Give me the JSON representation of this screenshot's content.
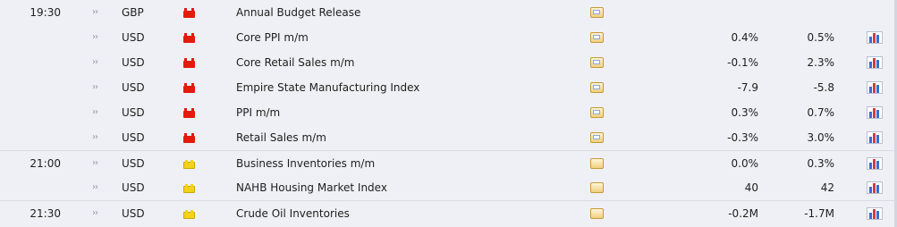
{
  "columns": [
    "time",
    "volatility",
    "currency",
    "importance",
    "event",
    "detail",
    "actual",
    "forecast",
    "chart"
  ],
  "colors": {
    "high_importance": "#e41a0d",
    "medium_importance": "#f3d21a",
    "row_bg": "#eef0f5"
  },
  "rows": [
    {
      "time": "19:30",
      "volatility": "››",
      "currency": "GBP",
      "importance": "high",
      "event": "Annual Budget Release",
      "detail_icon": "open-folder-icon",
      "actual": "",
      "forecast": "",
      "chart": false
    },
    {
      "time": "",
      "volatility": "››",
      "currency": "USD",
      "importance": "high",
      "event": "Core PPI m/m",
      "detail_icon": "open-folder-icon",
      "actual": "0.4%",
      "forecast": "0.5%",
      "chart": true
    },
    {
      "time": "",
      "volatility": "››",
      "currency": "USD",
      "importance": "high",
      "event": "Core Retail Sales m/m",
      "detail_icon": "open-folder-icon",
      "actual": "-0.1%",
      "forecast": "2.3%",
      "chart": true
    },
    {
      "time": "",
      "volatility": "››",
      "currency": "USD",
      "importance": "high",
      "event": "Empire State Manufacturing Index",
      "detail_icon": "open-folder-icon",
      "actual": "-7.9",
      "forecast": "-5.8",
      "chart": true
    },
    {
      "time": "",
      "volatility": "››",
      "currency": "USD",
      "importance": "high",
      "event": "PPI m/m",
      "detail_icon": "open-folder-icon",
      "actual": "0.3%",
      "forecast": "0.7%",
      "chart": true
    },
    {
      "time": "",
      "volatility": "››",
      "currency": "USD",
      "importance": "high",
      "event": "Retail Sales m/m",
      "detail_icon": "open-folder-icon",
      "actual": "-0.3%",
      "forecast": "3.0%",
      "chart": true
    },
    {
      "time": "21:00",
      "volatility": "››",
      "currency": "USD",
      "importance": "medium",
      "event": "Business Inventories m/m",
      "detail_icon": "folder-icon",
      "actual": "0.0%",
      "forecast": "0.3%",
      "chart": true
    },
    {
      "time": "",
      "volatility": "››",
      "currency": "USD",
      "importance": "medium",
      "event": "NAHB Housing Market Index",
      "detail_icon": "folder-icon",
      "actual": "40",
      "forecast": "42",
      "chart": true
    },
    {
      "time": "21:30",
      "volatility": "››",
      "currency": "USD",
      "importance": "medium",
      "event": "Crude Oil Inventories",
      "detail_icon": "folder-icon",
      "actual": "-0.2M",
      "forecast": "-1.7M",
      "chart": true
    }
  ]
}
